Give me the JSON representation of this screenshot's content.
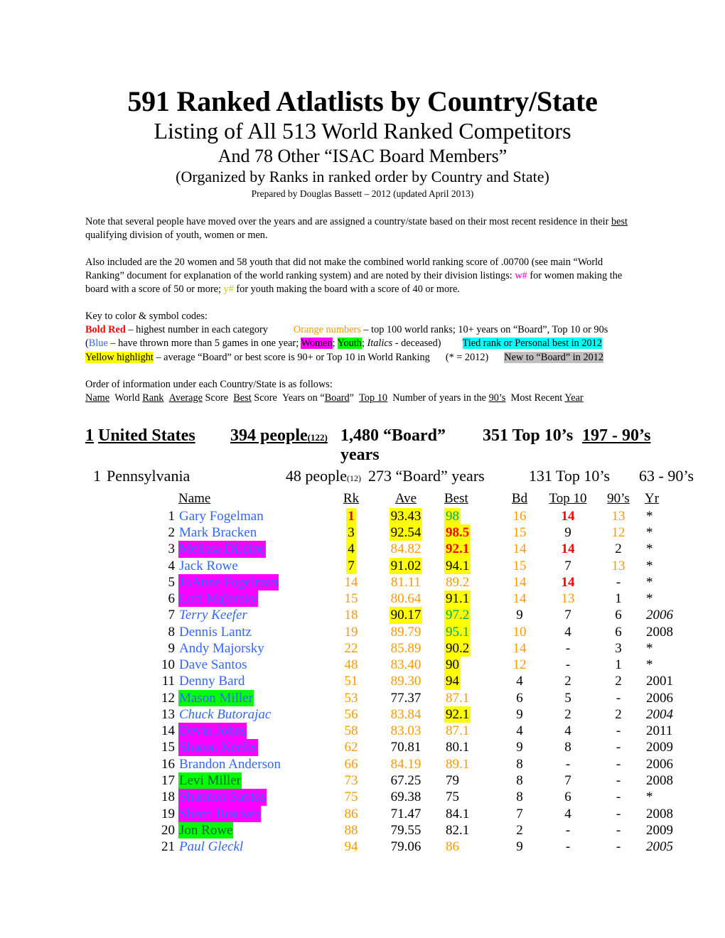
{
  "document": {
    "title_main": "591 Ranked Atlatlists by Country/State",
    "subtitle_1": "Listing of All 513 World Ranked Competitors",
    "subtitle_2": "And 78 Other “ISAC Board Members”",
    "subtitle_3": "(Organized by Ranks in ranked order by Country and State)",
    "prepared_by": "Prepared by Douglas Bassett – 2012 (updated April 2013)"
  },
  "notes": {
    "note_1_a": "Note that several people have moved over the years and are assigned a country/state based on their most recent residence in their ",
    "note_1_b": "best",
    "note_1_c": " qualifying division of youth, women or men.",
    "note_2_a": "Also included are the 20 women and 58 youth that did not make the combined world ranking score of .00700 (see main “World Ranking” document for explanation of the world ranking system) and are noted by their division listings: ",
    "note_2_w": "w#",
    "note_2_b": " for women making the board with a score of 50 or more; ",
    "note_2_y": "y#",
    "note_2_c": " for youth making the board with a score of 40 or more."
  },
  "key": {
    "heading": "Key to color & symbol codes:",
    "bold_red_label": "Bold Red",
    "bold_red_desc": " – highest number in each category",
    "orange_label": "Orange numbers",
    "orange_desc": " – top 100 world ranks; 10+ years on “Board”, Top 10 or 90s",
    "blue_open": "(",
    "blue_label": "Blue",
    "blue_desc": " – have thrown more than 5 games in one year; ",
    "women_label": "Women",
    "women_sep": "; ",
    "youth_label": "Youth",
    "youth_sep": "; ",
    "italics_label": "Italics",
    "italics_desc": " - deceased)",
    "cyan_label": "Tied rank or Personal best in 2012",
    "yellow_label": "Yellow highlight",
    "yellow_desc": " – average “Board” or best score is 90+ or Top 10 in World Ranking",
    "star_note": "(* = 2012)",
    "grey_label": "New to “Board” in 2012"
  },
  "order_info": {
    "heading": "Order of information under each Country/State is as follows:",
    "fields": [
      {
        "u": "Name",
        "p": ""
      },
      {
        "u": "Rank",
        "p": "World "
      },
      {
        "u": "Average",
        "p": "",
        "s": " Score"
      },
      {
        "u": "Best",
        "p": "",
        "s": " Score"
      },
      {
        "u": "Board",
        "p": "Years on “",
        "s": "”"
      },
      {
        "u": "Top 10",
        "p": ""
      },
      {
        "u": "90’s",
        "p": "Number of years in the "
      },
      {
        "u": "Year",
        "p": "Most Recent "
      }
    ]
  },
  "country": {
    "num": "1",
    "name": "United States",
    "people": "394 people",
    "people_sub": "(122)",
    "board_years": "1,480 “Board” years",
    "top10": "351 Top 10’s",
    "nineties": "197 - 90’s"
  },
  "state": {
    "num": "1",
    "name": "Pennsylvania",
    "people": "48 people",
    "people_sub": "(12)",
    "board_years": "273 “Board” years",
    "top10": "131 Top 10’s",
    "nineties": "63 - 90’s"
  },
  "table": {
    "headers": {
      "idx": "",
      "name": "Name",
      "rk": "Rk",
      "ave": "Ave",
      "best": "Best",
      "bd": "Bd",
      "top10": "Top 10",
      "nineties": "90’s",
      "yr": "Yr"
    },
    "rows": [
      {
        "idx": "1",
        "name": "Gary Fogelman",
        "name_style": "blue",
        "rk": "1",
        "rk_style": "red hl-y",
        "ave": "93.43",
        "ave_style": "black hl-y",
        "best": "98",
        "best_style": "green hl-y",
        "bd": "16",
        "bd_style": "orange",
        "top10": "14",
        "top10_style": "red",
        "n90": "13",
        "n90_style": "orange",
        "yr": "*",
        "yr_style": "black"
      },
      {
        "idx": "2",
        "name": "Mark Bracken",
        "name_style": "blue",
        "rk": "3",
        "rk_style": "black hl-y",
        "ave": "92.54",
        "ave_style": "black hl-y",
        "best": "98.5",
        "best_style": "red hl-y",
        "bd": "15",
        "bd_style": "orange",
        "top10": "9",
        "top10_style": "black",
        "n90": "12",
        "n90_style": "orange",
        "yr": "*",
        "yr_style": "black"
      },
      {
        "idx": "3",
        "name": "Melissa Dildine",
        "name_style": "blue hl-m",
        "rk": "4",
        "rk_style": "black hl-y",
        "ave": "84.82",
        "ave_style": "orange",
        "best": "92.1",
        "best_style": "red hl-y",
        "bd": "14",
        "bd_style": "orange",
        "top10": "14",
        "top10_style": "red",
        "n90": "2",
        "n90_style": "black",
        "yr": "*",
        "yr_style": "black"
      },
      {
        "idx": "4",
        "name": "Jack Rowe",
        "name_style": "blue",
        "rk": "7",
        "rk_style": "black hl-y",
        "ave": "91.02",
        "ave_style": "black hl-y",
        "best": "94.1",
        "best_style": "black hl-y",
        "bd": "15",
        "bd_style": "orange",
        "top10": "7",
        "top10_style": "black",
        "n90": "13",
        "n90_style": "orange",
        "yr": "*",
        "yr_style": "black"
      },
      {
        "idx": "5",
        "name": "JoAnne Fogelman",
        "name_style": "blue hl-m",
        "rk": "14",
        "rk_style": "orange",
        "ave": "81.11",
        "ave_style": "orange",
        "best": "89.2",
        "best_style": "orange",
        "bd": "14",
        "bd_style": "orange",
        "top10": "14",
        "top10_style": "red",
        "n90": "-",
        "n90_style": "black",
        "yr": "*",
        "yr_style": "black"
      },
      {
        "idx": "6",
        "name": "Lori Majorsky",
        "name_style": "blue hl-m",
        "rk": "15",
        "rk_style": "orange",
        "ave": "80.64",
        "ave_style": "orange",
        "best": "91.1",
        "best_style": "black hl-y",
        "bd": "14",
        "bd_style": "orange",
        "top10": "13",
        "top10_style": "orange",
        "n90": "1",
        "n90_style": "black",
        "yr": "*",
        "yr_style": "black"
      },
      {
        "idx": "7",
        "name": "Terry Keefer",
        "name_style": "blue it",
        "rk": "18",
        "rk_style": "orange",
        "ave": "90.17",
        "ave_style": "black hl-y",
        "best": "97.2",
        "best_style": "green hl-y",
        "bd": "9",
        "bd_style": "black",
        "top10": "7",
        "top10_style": "black",
        "n90": "6",
        "n90_style": "black",
        "yr": "2006",
        "yr_style": "black it"
      },
      {
        "idx": "8",
        "name": "Dennis Lantz",
        "name_style": "blue",
        "rk": "19",
        "rk_style": "orange",
        "ave": "89.79",
        "ave_style": "orange",
        "best": "95.1",
        "best_style": "green hl-y",
        "bd": "10",
        "bd_style": "orange",
        "top10": "4",
        "top10_style": "black",
        "n90": "6",
        "n90_style": "black",
        "yr": "2008",
        "yr_style": "black"
      },
      {
        "idx": "9",
        "name": "Andy Majorsky",
        "name_style": "blue",
        "rk": "22",
        "rk_style": "orange",
        "ave": "85.89",
        "ave_style": "orange",
        "best": "90.2",
        "best_style": "black hl-y",
        "bd": "14",
        "bd_style": "orange",
        "top10": "-",
        "top10_style": "black",
        "n90": "3",
        "n90_style": "black",
        "yr": "*",
        "yr_style": "black"
      },
      {
        "idx": "10",
        "name": "Dave Santos",
        "name_style": "blue",
        "rk": "48",
        "rk_style": "orange",
        "ave": "83.40",
        "ave_style": "orange",
        "best": "90",
        "best_style": "black hl-y",
        "bd": "12",
        "bd_style": "orange",
        "top10": "-",
        "top10_style": "black",
        "n90": "1",
        "n90_style": "black",
        "yr": "*",
        "yr_style": "black"
      },
      {
        "idx": "11",
        "name": "Denny Bard",
        "name_style": "blue",
        "rk": "51",
        "rk_style": "orange",
        "ave": "89.30",
        "ave_style": "orange",
        "best": "94",
        "best_style": "black hl-y",
        "bd": "4",
        "bd_style": "black",
        "top10": "2",
        "top10_style": "black",
        "n90": "2",
        "n90_style": "black",
        "yr": "2001",
        "yr_style": "black"
      },
      {
        "idx": "12",
        "name": "Mason Miller",
        "name_style": "blue hl-g",
        "rk": "53",
        "rk_style": "orange",
        "ave": "77.37",
        "ave_style": "black",
        "best": "87.1",
        "best_style": "orange",
        "bd": "6",
        "bd_style": "black",
        "top10": "5",
        "top10_style": "black",
        "n90": "-",
        "n90_style": "black",
        "yr": "2006",
        "yr_style": "black"
      },
      {
        "idx": "13",
        "name": "Chuck Butorajac",
        "name_style": "blue it",
        "rk": "56",
        "rk_style": "orange",
        "ave": "83.84",
        "ave_style": "orange",
        "best": "92.1",
        "best_style": "black hl-y",
        "bd": "9",
        "bd_style": "black",
        "top10": "2",
        "top10_style": "black",
        "n90": "2",
        "n90_style": "black",
        "yr": "2004",
        "yr_style": "black it"
      },
      {
        "idx": "14",
        "name": "Devin Johns",
        "name_style": "blue hl-m",
        "rk": "58",
        "rk_style": "orange",
        "ave": "83.03",
        "ave_style": "orange",
        "best": "87.1",
        "best_style": "orange",
        "bd": "4",
        "bd_style": "black",
        "top10": "4",
        "top10_style": "black",
        "n90": "-",
        "n90_style": "black",
        "yr": "2011",
        "yr_style": "black"
      },
      {
        "idx": "15",
        "name": "Sharon Keefer",
        "name_style": "blue hl-m",
        "rk": "62",
        "rk_style": "orange",
        "ave": "70.81",
        "ave_style": "black",
        "best": "80.1",
        "best_style": "black",
        "bd": "9",
        "bd_style": "black",
        "top10": "8",
        "top10_style": "black",
        "n90": "-",
        "n90_style": "black",
        "yr": "2009",
        "yr_style": "black"
      },
      {
        "idx": "16",
        "name": "Brandon Anderson",
        "name_style": "blue",
        "rk": "66",
        "rk_style": "orange",
        "ave": "84.19",
        "ave_style": "orange",
        "best": "89.1",
        "best_style": "orange",
        "bd": "8",
        "bd_style": "black",
        "top10": "-",
        "top10_style": "black",
        "n90": "-",
        "n90_style": "black",
        "yr": "2006",
        "yr_style": "black"
      },
      {
        "idx": "17",
        "name": "Levi Miller",
        "name_style": "dgreen hl-g",
        "rk": "73",
        "rk_style": "orange",
        "ave": "67.25",
        "ave_style": "black",
        "best": "79",
        "best_style": "black",
        "bd": "8",
        "bd_style": "black",
        "top10": "7",
        "top10_style": "black",
        "n90": "-",
        "n90_style": "black",
        "yr": "2008",
        "yr_style": "black"
      },
      {
        "idx": "18",
        "name": "Shannon Santos",
        "name_style": "blue hl-m",
        "rk": "75",
        "rk_style": "orange",
        "ave": "69.38",
        "ave_style": "black",
        "best": "75",
        "best_style": "black",
        "bd": "8",
        "bd_style": "black",
        "top10": "6",
        "top10_style": "black",
        "n90": "-",
        "n90_style": "black",
        "yr": "*",
        "yr_style": "black"
      },
      {
        "idx": "19",
        "name": "Sherri Bracken",
        "name_style": "blue hl-m",
        "rk": "86",
        "rk_style": "orange",
        "ave": "71.47",
        "ave_style": "black",
        "best": "84.1",
        "best_style": "black",
        "bd": "7",
        "bd_style": "black",
        "top10": "4",
        "top10_style": "black",
        "n90": "-",
        "n90_style": "black",
        "yr": "2008",
        "yr_style": "black"
      },
      {
        "idx": "20",
        "name": "Jon Rowe",
        "name_style": "dgreen hl-g",
        "rk": "88",
        "rk_style": "orange",
        "ave": "79.55",
        "ave_style": "black",
        "best": "82.1",
        "best_style": "black",
        "bd": "2",
        "bd_style": "black",
        "top10": "-",
        "top10_style": "black",
        "n90": "-",
        "n90_style": "black",
        "yr": "2009",
        "yr_style": "black"
      },
      {
        "idx": "21",
        "name": "Paul Gleckl",
        "name_style": "blue it",
        "rk": "94",
        "rk_style": "orange",
        "ave": "79.06",
        "ave_style": "black",
        "best": "86",
        "best_style": "orange",
        "bd": "9",
        "bd_style": "black",
        "top10": "-",
        "top10_style": "black",
        "n90": "-",
        "n90_style": "black",
        "yr": "2005",
        "yr_style": "black it"
      }
    ]
  }
}
